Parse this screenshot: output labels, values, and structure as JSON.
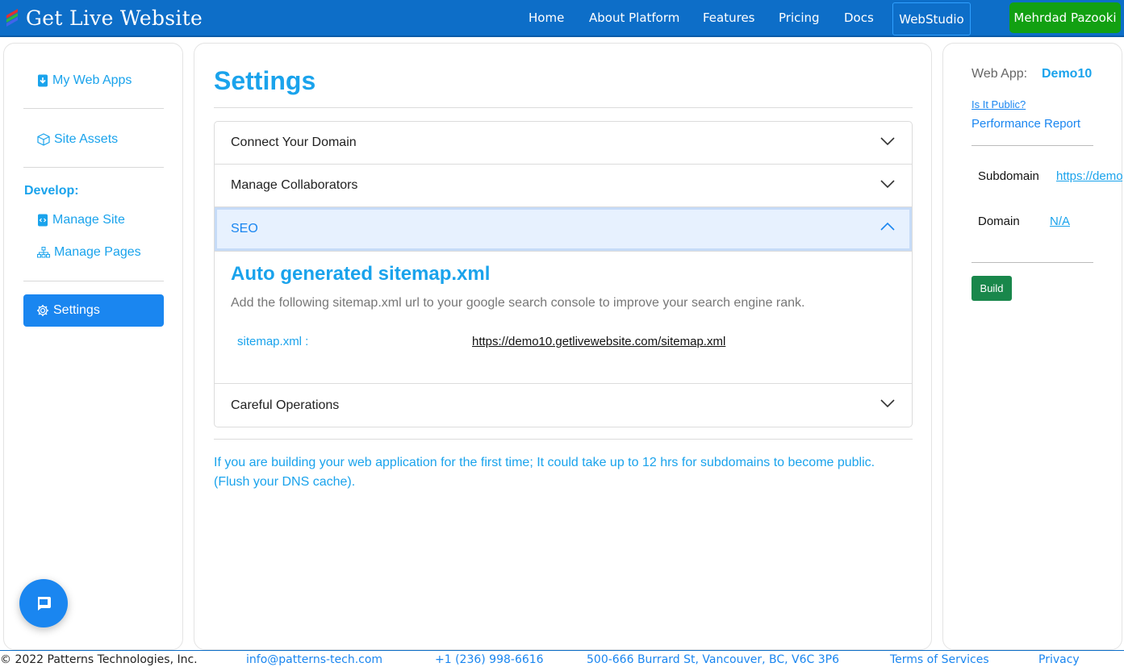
{
  "header": {
    "brand": "Get Live Website",
    "nav": [
      "Home",
      "About Platform",
      "Features",
      "Pricing",
      "Docs"
    ],
    "webstudio": "WebStudio",
    "user": "Mehrdad Pazooki"
  },
  "sidebar": {
    "my_web_apps": "My Web Apps",
    "site_assets": "Site Assets",
    "develop_heading": "Develop:",
    "manage_site": "Manage Site",
    "manage_pages": "Manage Pages",
    "settings": "Settings"
  },
  "main": {
    "title": "Settings",
    "sections": {
      "domain": "Connect Your Domain",
      "collaborators": "Manage Collaborators",
      "seo": "SEO",
      "careful": "Careful Operations"
    },
    "seo": {
      "heading": "Auto generated sitemap.xml",
      "description": "Add the following sitemap.xml url to your google search console to improve your search engine rank.",
      "sitemap_label": "sitemap.xml :",
      "sitemap_url": "https://demo10.getlivewebsite.com/sitemap.xml"
    },
    "notice": "If you are building your web application for the first time; It could take up to 12 hrs for subdomains to become public. (Flush your DNS cache)."
  },
  "right": {
    "web_app_label": "Web App:",
    "web_app_name": "Demo10",
    "is_public": "Is It Public?",
    "performance_report": "Performance Report",
    "subdomain_label": "Subdomain",
    "subdomain_value": "https://demo",
    "domain_label": "Domain",
    "domain_value": "N/A",
    "build": "Build"
  },
  "footer": {
    "copyright": "© 2022 Patterns Technologies, Inc.",
    "email": "info@patterns-tech.com",
    "phone": "+1 (236) 998-6616",
    "address": "500-666 Burrard St, Vancouver, BC, V6C 3P6",
    "terms": "Terms of Services",
    "privacy": "Privacy"
  },
  "colors": {
    "nav_bg": "#0d6ec8",
    "accent": "#1aa3ec",
    "primary": "#1a86f0",
    "user_btn": "#12a012",
    "build_btn": "#19874b"
  }
}
